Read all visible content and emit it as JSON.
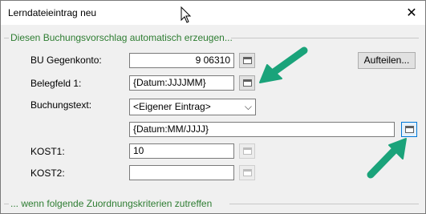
{
  "window": {
    "title": "Lerndateieintrag neu",
    "close_glyph": "✕"
  },
  "group1": {
    "title": "Diesen Buchungsvorschlag automatisch erzeugen..."
  },
  "group2": {
    "title": "... wenn folgende Zuordnungskriterien zutreffen"
  },
  "form": {
    "bu_gegenkonto": {
      "label": "BU Gegenkonto:",
      "value": "9 06310"
    },
    "belegfeld1": {
      "label": "Belegfeld 1:",
      "value": "{Datum:JJJJMM}"
    },
    "buchungstext": {
      "label": "Buchungstext:",
      "selected": "<Eigener Eintrag>",
      "custom_value": "{Datum:MM/JJJJ}"
    },
    "kost1": {
      "label": "KOST1:",
      "value": "10"
    },
    "kost2": {
      "label": "KOST2:",
      "value": ""
    }
  },
  "buttons": {
    "aufteilen": "Aufteilen..."
  },
  "annotation": {
    "arrow_color": "#1aa37a"
  },
  "icons": {
    "picker": "field-picker-icon",
    "cursor": "mouse-cursor-icon",
    "dropdown": "chevron-down-icon"
  }
}
